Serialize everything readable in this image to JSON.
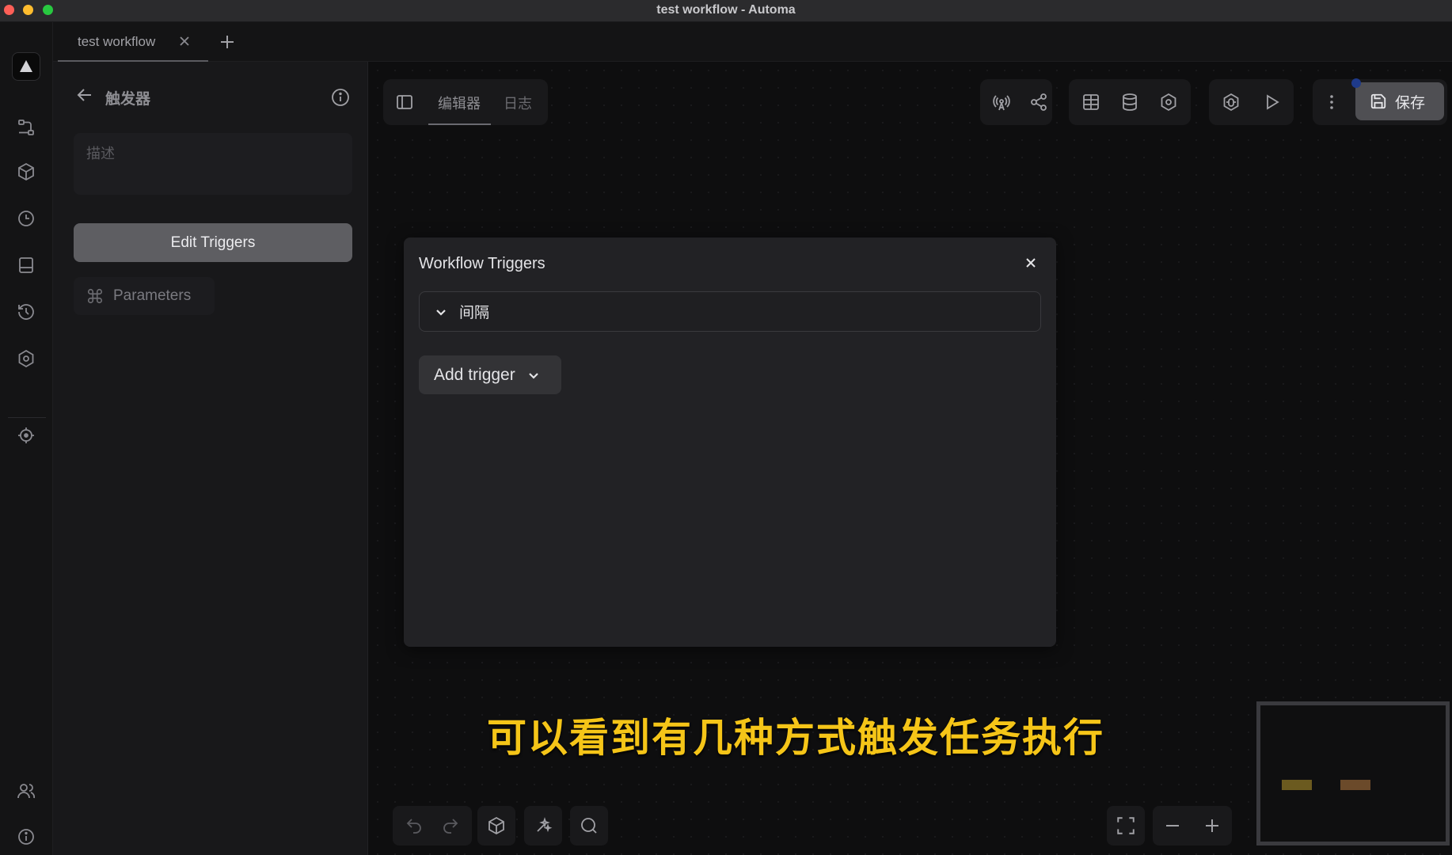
{
  "window": {
    "title": "test workflow - Automa"
  },
  "tabs": [
    {
      "label": "test workflow"
    }
  ],
  "sidebar_rail": {
    "icons": [
      "logo-icon",
      "workflows-icon",
      "packages-icon",
      "schedule-icon",
      "storage-icon",
      "history-icon",
      "settings-icon",
      "recording-icon",
      "team-icon",
      "about-icon"
    ]
  },
  "side_panel": {
    "title": "触发器",
    "description_placeholder": "描述",
    "edit_triggers_label": "Edit Triggers",
    "parameters_label": "Parameters"
  },
  "editor": {
    "tabs": [
      {
        "label": "编辑器",
        "active": true
      },
      {
        "label": "日志",
        "active": false
      }
    ],
    "save_label": "保存"
  },
  "modal": {
    "title": "Workflow Triggers",
    "triggers": [
      {
        "label": "间隔",
        "expanded": false
      }
    ],
    "add_trigger_label": "Add trigger"
  },
  "subtitle": "可以看到有几种方式触发任务执行",
  "colors": {
    "accent_save": "#4f4f53",
    "subtitle": "#f5c518",
    "background": "#0f0f10"
  }
}
